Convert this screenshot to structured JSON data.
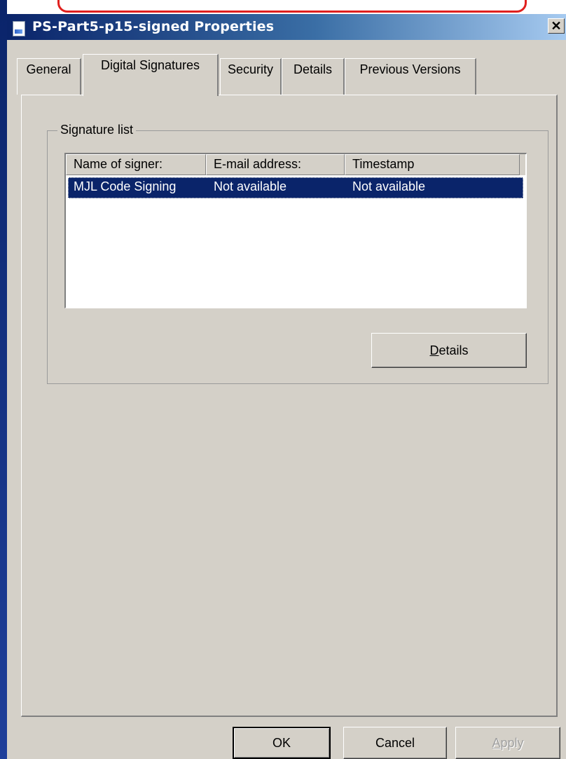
{
  "window": {
    "title": "PS-Part5-p15-signed Properties",
    "close_glyph": "✕"
  },
  "tabs": [
    {
      "label": "General",
      "active": false
    },
    {
      "label": "Digital Signatures",
      "active": true
    },
    {
      "label": "Security",
      "active": false
    },
    {
      "label": "Details",
      "active": false
    },
    {
      "label": "Previous Versions",
      "active": false
    }
  ],
  "signature_list": {
    "group_label": "Signature list",
    "columns": [
      "Name of signer:",
      "E-mail address:",
      "Timestamp"
    ],
    "rows": [
      {
        "name": "MJL Code Signing",
        "email": "Not available",
        "timestamp": "Not available",
        "selected": true
      }
    ],
    "details_button": {
      "mnemonic": "D",
      "rest": "etails"
    }
  },
  "footer": {
    "ok": "OK",
    "cancel": "Cancel",
    "apply": {
      "mnemonic": "A",
      "rest": "pply",
      "disabled": true
    }
  },
  "colors": {
    "selection": "#0a246a",
    "face": "#d4d0c8",
    "annotation": "#e0201e"
  },
  "icons": {
    "window_icon": "document-icon",
    "close": "close-icon"
  }
}
